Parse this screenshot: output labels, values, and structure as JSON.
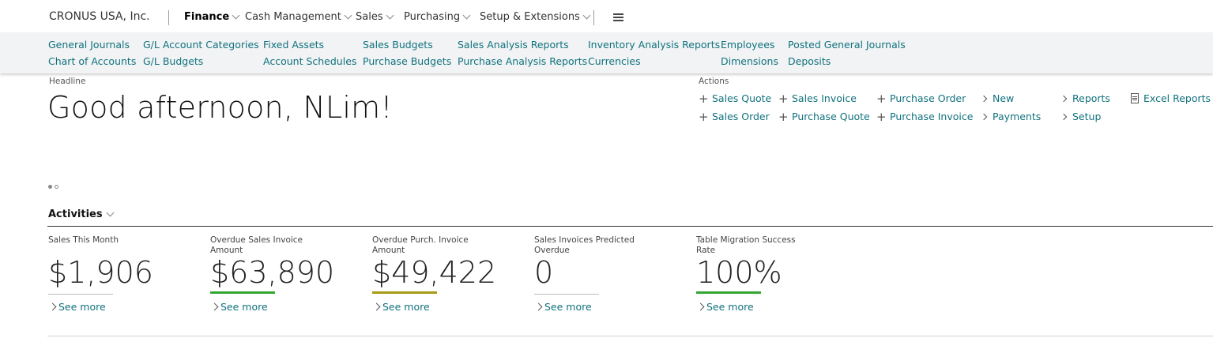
{
  "company": "CRONUS USA, Inc.",
  "nav": [
    {
      "label": "Finance",
      "active": true
    },
    {
      "label": "Cash Management",
      "active": false
    },
    {
      "label": "Sales",
      "active": false
    },
    {
      "label": "Purchasing",
      "active": false
    },
    {
      "label": "Setup & Extensions",
      "active": false
    }
  ],
  "sub_links": [
    [
      "General Journals",
      "Chart of Accounts"
    ],
    [
      "G/L Account Categories",
      "G/L Budgets"
    ],
    [
      "Fixed Assets",
      "Account Schedules"
    ],
    [
      "Sales Budgets",
      "Purchase Budgets"
    ],
    [
      "Sales Analysis Reports",
      "Purchase Analysis Reports"
    ],
    [
      "Inventory Analysis Reports",
      "Currencies"
    ],
    [
      "Employees",
      "Dimensions"
    ],
    [
      "Posted General Journals",
      "Deposits"
    ]
  ],
  "headline": {
    "caption": "Headline",
    "text": "Good afternoon, NLim!"
  },
  "actions": {
    "caption": "Actions",
    "columns": [
      [
        {
          "label": "Sales Quote",
          "icon": "plus-icon"
        },
        {
          "label": "Sales Order",
          "icon": "plus-icon"
        }
      ],
      [
        {
          "label": "Sales Invoice",
          "icon": "plus-icon"
        },
        {
          "label": "Purchase Quote",
          "icon": "plus-icon"
        }
      ],
      [
        {
          "label": "Purchase Order",
          "icon": "plus-icon"
        },
        {
          "label": "Purchase Invoice",
          "icon": "plus-icon"
        }
      ],
      [
        {
          "label": "New",
          "icon": "chevron-right-icon"
        },
        {
          "label": "Payments",
          "icon": "chevron-right-icon"
        }
      ],
      [
        {
          "label": "Reports",
          "icon": "chevron-right-icon"
        },
        {
          "label": "Setup",
          "icon": "chevron-right-icon"
        }
      ],
      [
        {
          "label": "Excel Reports",
          "icon": "document-icon"
        }
      ]
    ]
  },
  "activities": {
    "title": "Activities",
    "see_more": "See more",
    "tiles": [
      {
        "caption": "Sales This Month",
        "value": "$1,906",
        "bar_color": ""
      },
      {
        "caption": "Overdue Sales Invoice Amount",
        "value": "$63,890",
        "bar_color": "#33a532"
      },
      {
        "caption": "Overdue Purch. Invoice Amount",
        "value": "$49,422",
        "bar_color": "#a89a16"
      },
      {
        "caption": "Sales Invoices Predicted Overdue",
        "value": "0",
        "bar_color": ""
      },
      {
        "caption": "Table Migration Success Rate",
        "value": "100%",
        "bar_color": "#33a532"
      }
    ]
  },
  "colors": {
    "link": "#11727e",
    "subbar_bg": "#f1f3f4"
  }
}
